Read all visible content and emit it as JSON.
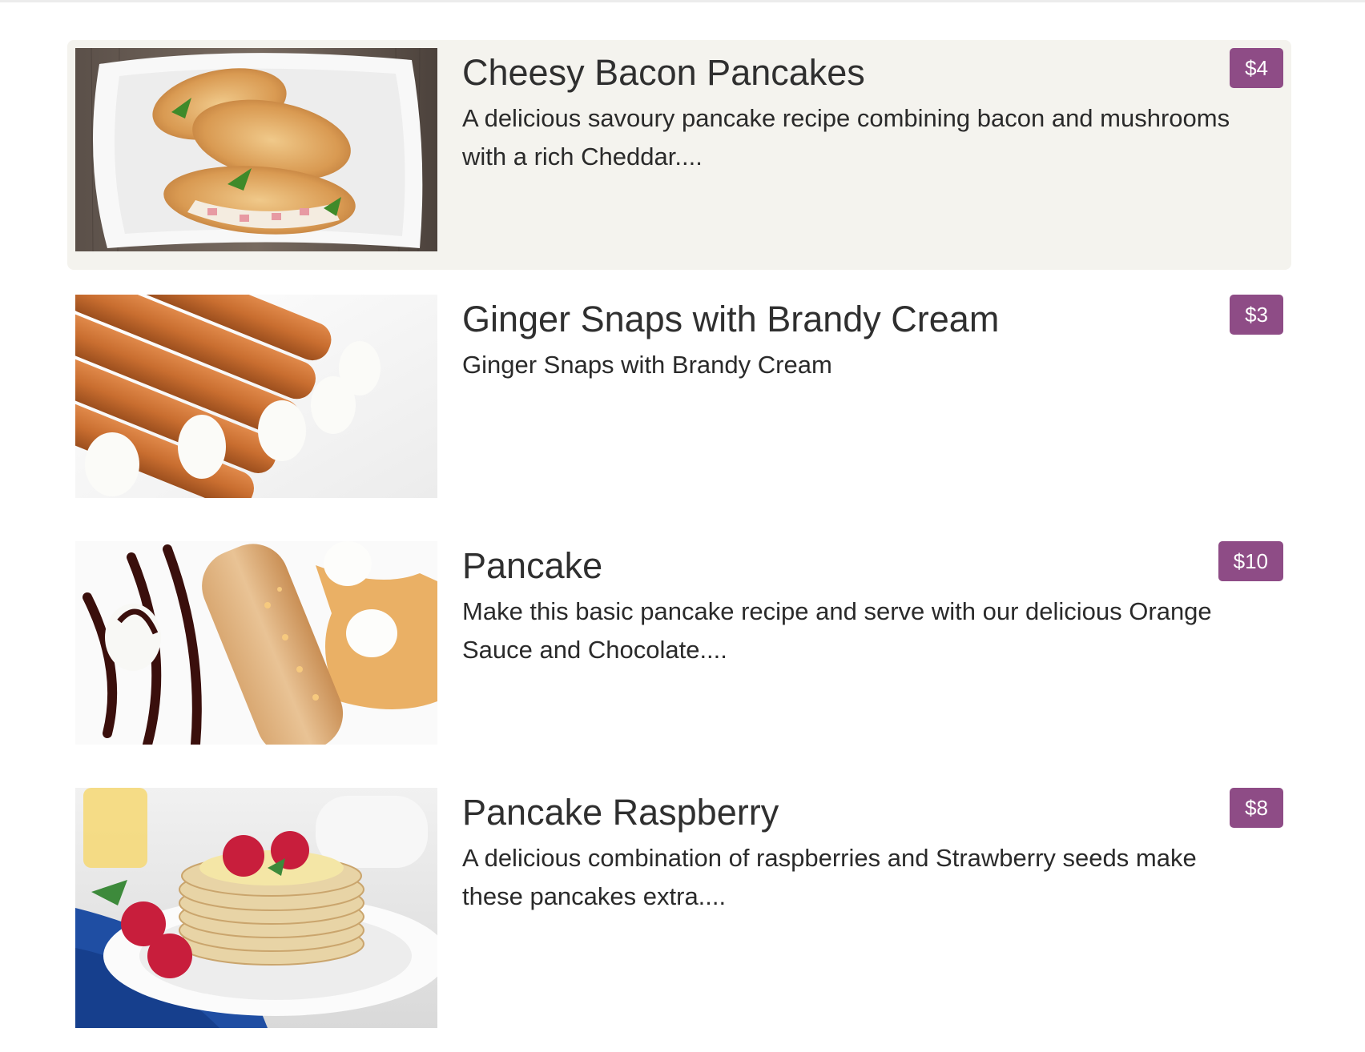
{
  "menu": {
    "items": [
      {
        "title": "Cheesy Bacon Pancakes",
        "description": "A delicious savoury pancake recipe combining bacon and mushrooms with a rich Cheddar....",
        "price": "$4",
        "image_icon": "cheesy-bacon-pancakes-photo"
      },
      {
        "title": "Ginger Snaps with Brandy Cream",
        "description": "Ginger Snaps with Brandy Cream",
        "price": "$3",
        "image_icon": "ginger-snaps-photo"
      },
      {
        "title": "Pancake",
        "description": "Make this basic pancake recipe and serve with our delicious Orange Sauce and Chocolate....",
        "price": "$10",
        "image_icon": "pancake-photo"
      },
      {
        "title": "Pancake Raspberry",
        "description": "A delicious combination of raspberries and Strawberry seeds make these pancakes extra....",
        "price": "$8",
        "image_icon": "pancake-raspberry-photo"
      }
    ]
  },
  "colors": {
    "price_badge": "#8e4c86",
    "highlight_row": "#f4f3ee",
    "text": "#2f2f2f"
  }
}
